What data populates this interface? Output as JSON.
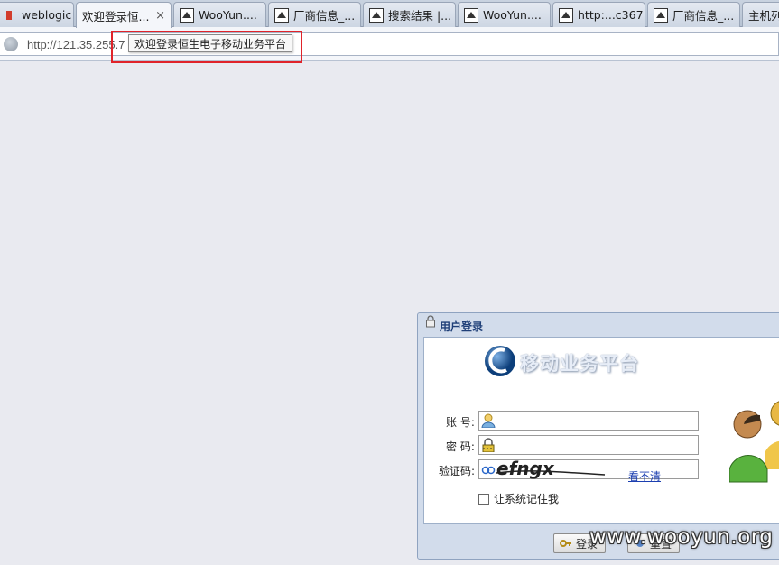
{
  "browser": {
    "tabs": [
      {
        "label": "weblogic ...",
        "icon": "red-icon"
      },
      {
        "label": "欢迎登录恒...",
        "icon": "none",
        "active": true,
        "close": "×"
      },
      {
        "label": "WooYun....",
        "icon": "wooyun-icon"
      },
      {
        "label": "厂商信息_...",
        "icon": "wooyun-icon"
      },
      {
        "label": "搜索结果 |...",
        "icon": "wooyun-icon"
      },
      {
        "label": "WooYun....",
        "icon": "wooyun-icon"
      },
      {
        "label": "http:...c367",
        "icon": "wooyun-icon"
      },
      {
        "label": "厂商信息_...",
        "icon": "wooyun-icon"
      },
      {
        "label": "主机列",
        "icon": "none"
      }
    ],
    "url": "http://121.35.255.7",
    "tooltip": "欢迎登录恒生电子移动业务平台"
  },
  "login": {
    "title": "用户登录",
    "brand": "移动业务平台",
    "account_label": "账  号:",
    "password_label": "密  码:",
    "captcha_label": "验证码:",
    "captcha_text": "efngx",
    "unclear_link": "看不清",
    "remember_label": "让系统记住我",
    "login_button": "登录",
    "reset_button": "重置"
  },
  "watermark": "www.wooyun.org"
}
